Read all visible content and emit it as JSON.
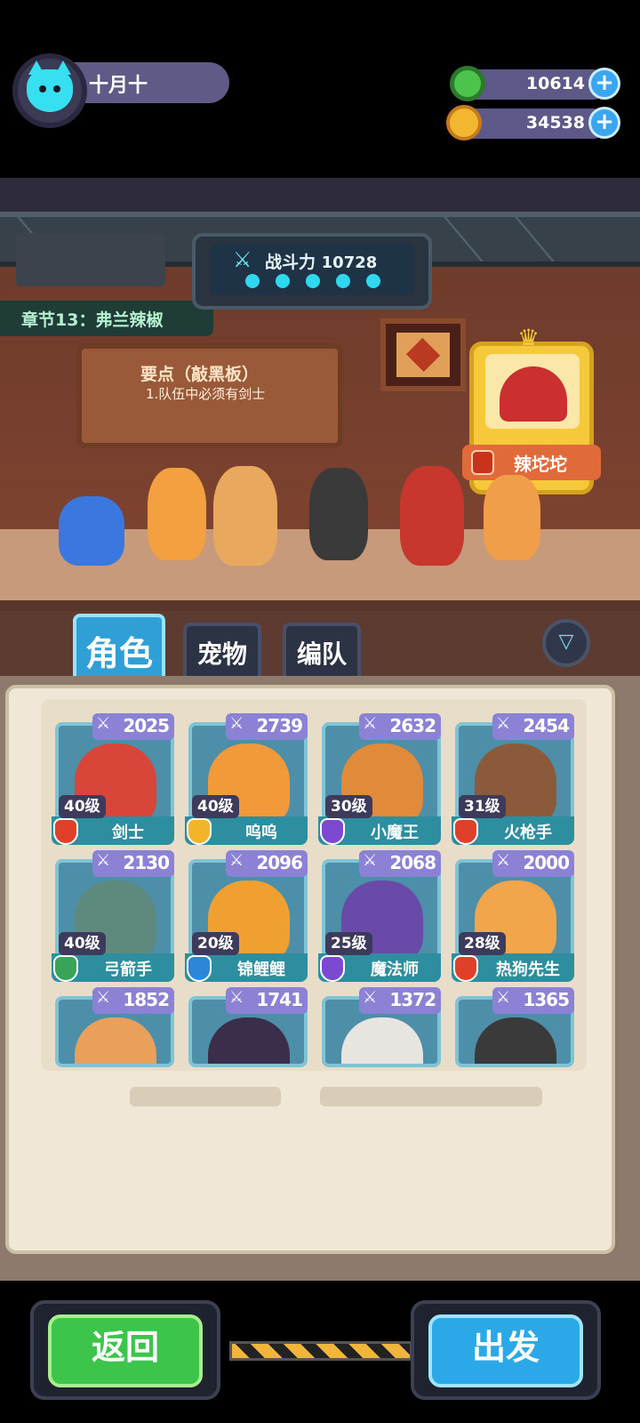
{
  "player": {
    "name": "十月十"
  },
  "currencies": [
    {
      "icon": "green-coin-icon",
      "value": "10614",
      "color": "#4cc34a"
    },
    {
      "icon": "gold-planet-icon",
      "value": "34538",
      "color": "#f2b631"
    }
  ],
  "stage": {
    "chapter": "章节13：弗兰辣椒",
    "power_label": "战斗力",
    "power_value": "10728",
    "tip_title": "要点（敲黑板）",
    "tip_text": "1.队伍中必须有剑士",
    "boss_name": "辣坨坨"
  },
  "tabs": [
    {
      "label": "角色",
      "active": true
    },
    {
      "label": "宠物",
      "active": false
    },
    {
      "label": "编队",
      "active": false
    }
  ],
  "characters": [
    {
      "power": "2025",
      "level": "40级",
      "name": "剑士",
      "element": "fire",
      "elem_color": "#e0402a",
      "art_color": "#d8463a"
    },
    {
      "power": "2739",
      "level": "40级",
      "name": "呜呜",
      "element": "light",
      "elem_color": "#f2b52a",
      "art_color": "#f29a3a"
    },
    {
      "power": "2632",
      "level": "30级",
      "name": "小魔王",
      "element": "dark",
      "elem_color": "#7b4ad0",
      "art_color": "#e08a3a"
    },
    {
      "power": "2454",
      "level": "31级",
      "name": "火枪手",
      "element": "fire",
      "elem_color": "#e0402a",
      "art_color": "#8a5a3a"
    },
    {
      "power": "2130",
      "level": "40级",
      "name": "弓箭手",
      "element": "wind",
      "elem_color": "#3aa35a",
      "art_color": "#5e8a7e"
    },
    {
      "power": "2096",
      "level": "20级",
      "name": "锦鲤鲤",
      "element": "water",
      "elem_color": "#2e86d8",
      "art_color": "#f0a030"
    },
    {
      "power": "2068",
      "level": "25级",
      "name": "魔法师",
      "element": "dark",
      "elem_color": "#7b4ad0",
      "art_color": "#6a4aa8"
    },
    {
      "power": "2000",
      "level": "28级",
      "name": "热狗先生",
      "element": "fire",
      "elem_color": "#e0402a",
      "art_color": "#f2a54a"
    },
    {
      "power": "1852",
      "art_color": "#e8a05a"
    },
    {
      "power": "1741",
      "art_color": "#3a2e4a"
    },
    {
      "power": "1372",
      "art_color": "#e8e4e0"
    },
    {
      "power": "1365",
      "art_color": "#3a3a3a"
    }
  ],
  "buttons": {
    "back": "返回",
    "go": "出发"
  }
}
